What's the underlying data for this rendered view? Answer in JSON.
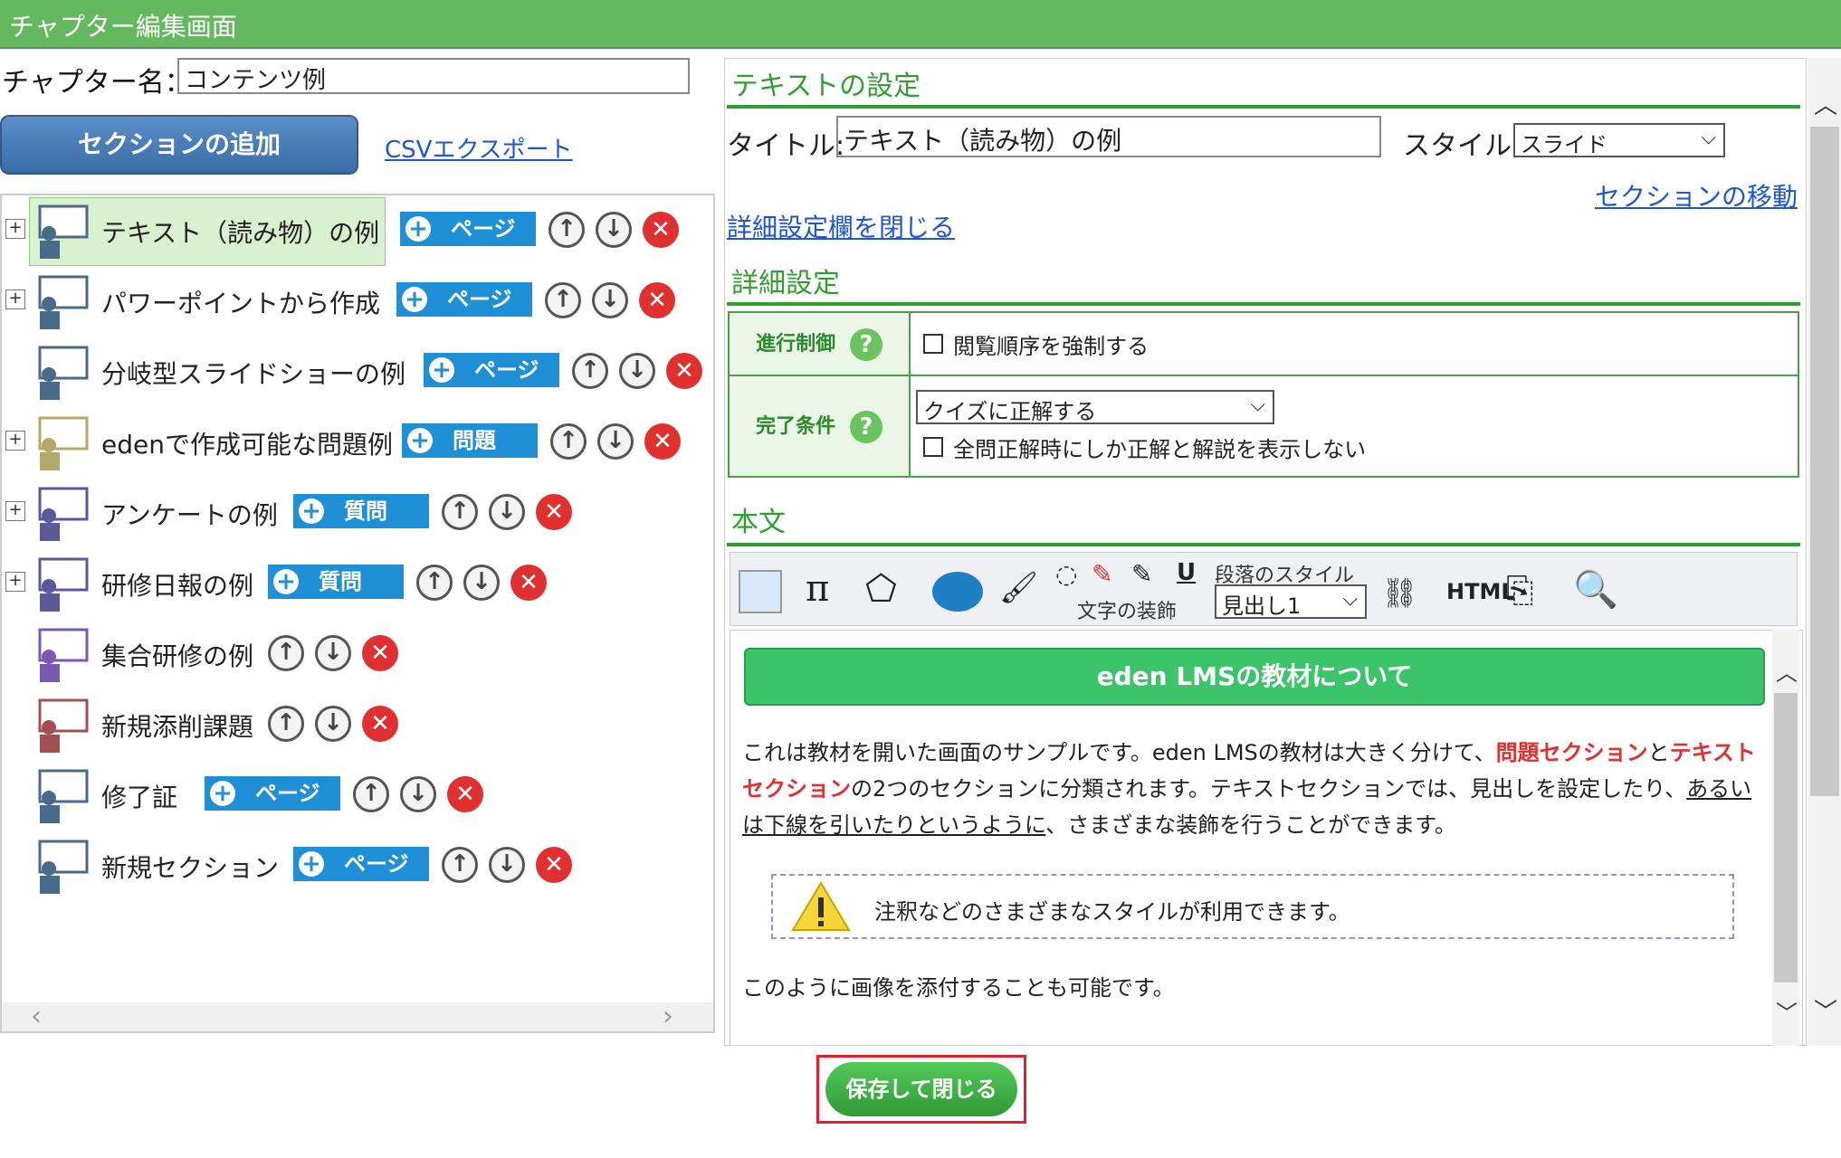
{
  "window": {
    "title": "チャプター編集画面"
  },
  "chapter": {
    "label": "チャプター名：",
    "name_value": "コンテンツ例"
  },
  "left": {
    "add_section_label": "セクションの追加",
    "csv_export_label": "CSVエクスポート",
    "sections": [
      {
        "label": "テキスト（読み物）の例",
        "tag": "ページ",
        "icon": "teacher-icon",
        "expandable": true,
        "selected": true
      },
      {
        "label": "パワーポイントから作成",
        "tag": "ページ",
        "icon": "teacher-icon",
        "expandable": true
      },
      {
        "label": "分岐型スライドショーの例",
        "tag": "ページ",
        "icon": "teacher-icon",
        "expandable": false
      },
      {
        "label": "edenで作成可能な問題例",
        "tag": "問題",
        "icon": "student-desk-icon",
        "expandable": true
      },
      {
        "label": "アンケートの例",
        "tag": "質問",
        "icon": "clipboard-icon",
        "expandable": true
      },
      {
        "label": "研修日報の例",
        "tag": "質問",
        "icon": "clipboard-icon",
        "expandable": true
      },
      {
        "label": "集合研修の例",
        "tag": "",
        "icon": "group-icon",
        "expandable": false
      },
      {
        "label": "新規添削課題",
        "tag": "",
        "icon": "postbox-icon",
        "expandable": false
      },
      {
        "label": "修了証",
        "tag": "ページ",
        "icon": "teacher-icon",
        "expandable": false
      },
      {
        "label": "新規セクション",
        "tag": "ページ",
        "icon": "teacher-icon",
        "expandable": false
      }
    ]
  },
  "right": {
    "text_settings_heading": "テキストの設定",
    "title_label": "タイトル:",
    "title_value": "テキスト（読み物）の例",
    "style_label": "スタイル:",
    "style_value": "スライド",
    "section_move_label": "セクションの移動",
    "close_detail_label": "詳細設定欄を閉じる",
    "detail_heading": "詳細設定",
    "progress_control_label": "進行制御",
    "progress_control_option": "閲覧順序を強制する",
    "completion_label": "完了条件",
    "completion_value": "クイズに正解する",
    "completion_option": "全問正解時にしか正解と解説を表示しない",
    "body_heading": "本文",
    "toolbar": {
      "paragraph_style_label": "段落のスタイル",
      "paragraph_style_value": "見出し1",
      "text_decoration_label": "文字の装飾",
      "html_label": "HTML"
    },
    "editor": {
      "banner": "eden LMSの教材について",
      "p1_a": "これは教材を開いた画面のサンプルです。eden LMSの教材は大きく分けて、",
      "p1_em1": "問題セクション",
      "p1_b": "と",
      "p1_em2": "テキストセクション",
      "p1_c": "の2つのセクションに分類されます。テキストセクションでは、見出しを設定したり、",
      "p1_ul": "あるいは下線を引いたりというように",
      "p1_d": "、さまざまな装飾を行うことができます。",
      "note": "注釈などのさまざまなスタイルが利用できます。",
      "p2": "このように画像を添付することも可能です。"
    }
  },
  "footer": {
    "save_close_label": "保存して閉じる"
  },
  "colors": {
    "titlebar": "#64b960",
    "heading_green": "#2ea02e",
    "banner_green": "#3cc46b",
    "delete_red": "#e03030",
    "tag_blue": "#1f8fd6"
  }
}
